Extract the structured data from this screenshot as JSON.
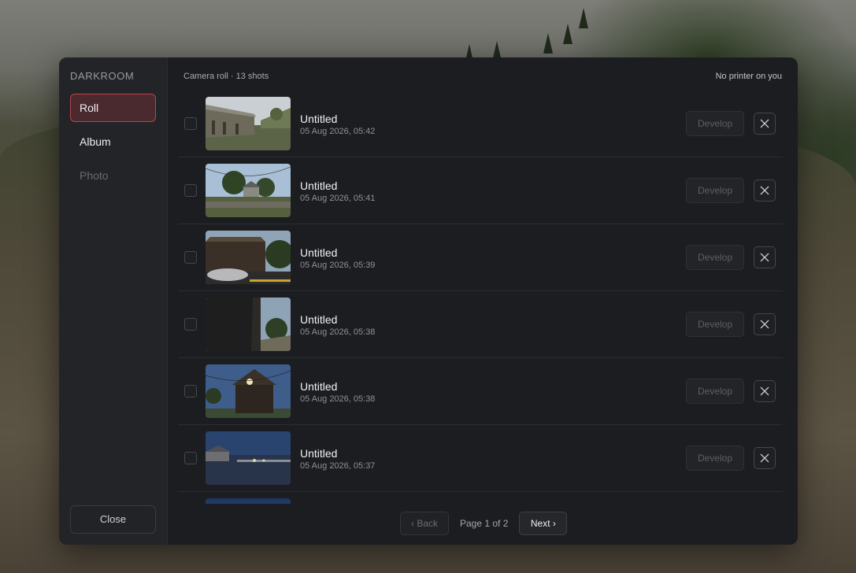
{
  "sidebar": {
    "brand": "DARKROOM",
    "items": [
      {
        "label": "Roll",
        "state": "active"
      },
      {
        "label": "Album",
        "state": "normal"
      },
      {
        "label": "Photo",
        "state": "disabled"
      }
    ],
    "close_label": "Close"
  },
  "header": {
    "left": "Camera roll · 13 shots",
    "right": "No printer on you"
  },
  "rows": [
    {
      "title": "Untitled",
      "date": "05 Aug 2026, 05:42",
      "develop_label": "Develop",
      "thumb": "building-daytime"
    },
    {
      "title": "Untitled",
      "date": "05 Aug 2026, 05:41",
      "develop_label": "Develop",
      "thumb": "trees-road"
    },
    {
      "title": "Untitled",
      "date": "05 Aug 2026, 05:39",
      "develop_label": "Develop",
      "thumb": "house-car"
    },
    {
      "title": "Untitled",
      "date": "05 Aug 2026, 05:38",
      "develop_label": "Develop",
      "thumb": "dark-wall"
    },
    {
      "title": "Untitled",
      "date": "05 Aug 2026, 05:38",
      "develop_label": "Develop",
      "thumb": "barn-dusk"
    },
    {
      "title": "Untitled",
      "date": "05 Aug 2026, 05:37",
      "develop_label": "Develop",
      "thumb": "night-field"
    }
  ],
  "pagination": {
    "back_label": "‹ Back",
    "page_label": "Page 1 of 2",
    "next_label": "Next ›"
  },
  "icons": {
    "delete": "close-x-icon",
    "checkbox": "checkbox-empty"
  },
  "colors": {
    "accent": "#b8454e",
    "panel": "#1c1d20",
    "sidebar": "#232427"
  }
}
